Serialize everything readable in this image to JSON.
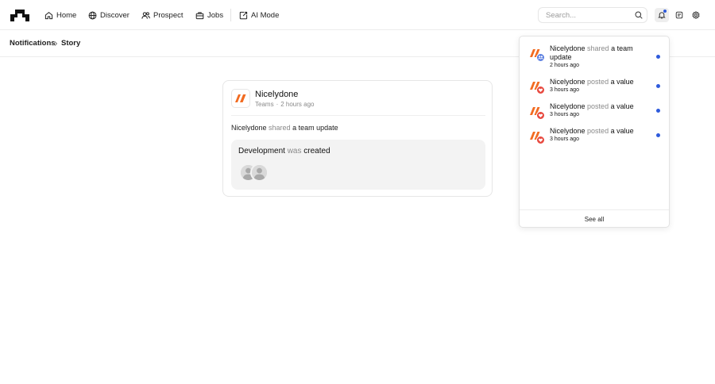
{
  "nav": {
    "items": [
      {
        "label": "Home",
        "icon": "home-icon"
      },
      {
        "label": "Discover",
        "icon": "globe-icon"
      },
      {
        "label": "Prospect",
        "icon": "users-icon"
      },
      {
        "label": "Jobs",
        "icon": "briefcase-icon"
      },
      {
        "label": "AI Mode",
        "icon": "ai-mode-icon"
      }
    ],
    "search_placeholder": "Search...",
    "search_value": ""
  },
  "breadcrumb": {
    "items": [
      "Notifications",
      "Story"
    ]
  },
  "story": {
    "org_name": "Nicelydone",
    "org_type": "Teams",
    "time": "2 hours ago",
    "actor": "Nicelydone",
    "verb": "shared",
    "object": "a team update",
    "update": {
      "subject": "Development",
      "verb": "was",
      "state": "created"
    }
  },
  "notifications": {
    "items": [
      {
        "actor": "Nicelydone",
        "verb": "shared",
        "object": "a team update",
        "time": "2 hours ago",
        "badge": "team-badge-icon",
        "unread": true
      },
      {
        "actor": "Nicelydone",
        "verb": "posted",
        "object": "a value",
        "time": "3 hours ago",
        "badge": "heart-badge-icon",
        "unread": true
      },
      {
        "actor": "Nicelydone",
        "verb": "posted",
        "object": "a value",
        "time": "3 hours ago",
        "badge": "heart-badge-icon",
        "unread": true
      },
      {
        "actor": "Nicelydone",
        "verb": "posted",
        "object": "a value",
        "time": "3 hours ago",
        "badge": "heart-badge-icon",
        "unread": true
      }
    ],
    "see_all": "See all"
  },
  "colors": {
    "brand_orange": "#f26b21",
    "unread_blue": "#2e5bdc",
    "badge_blue": "#5b7fe0",
    "badge_red": "#e8493f"
  }
}
